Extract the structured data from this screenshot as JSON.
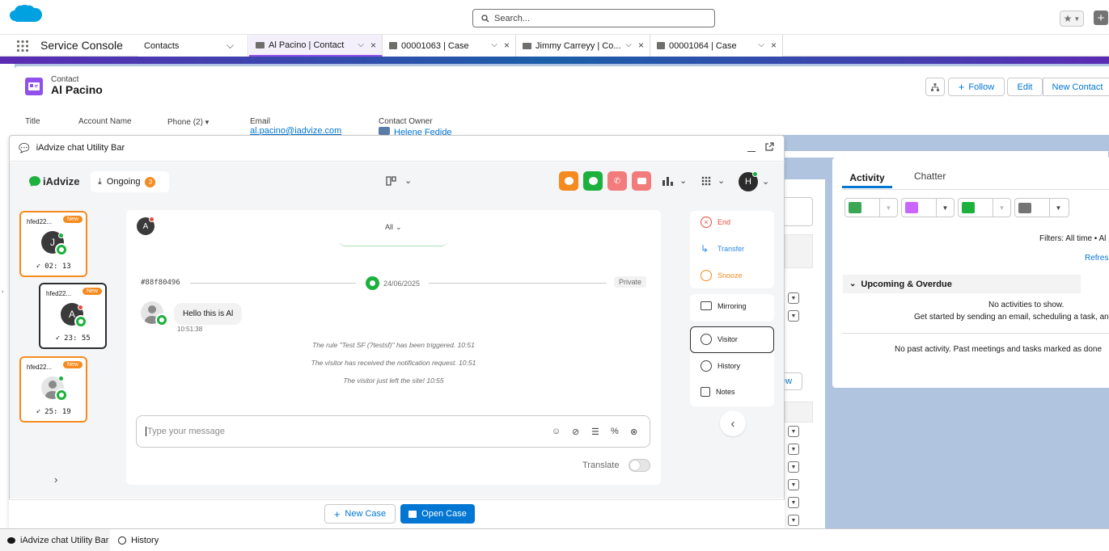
{
  "global_header": {
    "search_placeholder": "Search...",
    "add_label": "+"
  },
  "console": {
    "app_name": "Service Console",
    "nav_select": "Contacts",
    "tabs": [
      {
        "label": "Al Pacino | Contact",
        "active": true
      },
      {
        "label": "00001063 | Case",
        "active": false
      },
      {
        "label": "Jimmy Carreyy | Co...",
        "active": false
      },
      {
        "label": "00001064 | Case",
        "active": false
      }
    ]
  },
  "record": {
    "object_label": "Contact",
    "name": "Al Pacino",
    "actions": {
      "follow": "Follow",
      "edit": "Edit",
      "new_contact": "New Contact"
    },
    "fields": {
      "title_label": "Title",
      "account_label": "Account Name",
      "phone_label": "Phone (2)",
      "email_label": "Email",
      "email_value": "al.pacino@iadvize.com",
      "owner_label": "Contact Owner",
      "owner_value": "Helene Fedide"
    }
  },
  "activity": {
    "tab_activity": "Activity",
    "tab_chatter": "Chatter",
    "filters": "Filters: All time • Al",
    "refresh": "Refresh",
    "section": "Upcoming & Overdue",
    "no_activities": "No activities to show.",
    "get_started": "Get started by sending an email, scheduling a task, an",
    "no_past": "No past activity. Past meetings and tasks marked as done",
    "colors": {
      "task": "#3ba755",
      "event": "#cb65ff",
      "call": "#1bb13c",
      "email": "#747474"
    }
  },
  "behind": {
    "new_btn_fragment": "ew"
  },
  "utility_popup": {
    "title": "iAdvize chat Utility Bar"
  },
  "iadvize": {
    "logo": "iAdvize",
    "ongoing_label": "Ongoing",
    "ongoing_count": "3",
    "agent_initial": "H",
    "colors": {
      "orange": "#f58b1f",
      "green": "#1bb13c",
      "red": "#f27c7c",
      "accent": "#f58b1f"
    },
    "conversations": [
      {
        "id": "hfed22...",
        "badge": "New",
        "initial": "J",
        "timer": "02: 13",
        "status_color": "#1bb13c"
      },
      {
        "id": "hfed22...",
        "badge": "New",
        "initial": "A",
        "timer": "23: 55",
        "status_color": "#e74c3c"
      },
      {
        "id": "hfed22...",
        "badge": "New",
        "initial": "",
        "timer": "25: 19",
        "status_color": "#1bb13c"
      }
    ],
    "chat": {
      "visitor_initial": "A",
      "filter": "All",
      "conv_id": "#88f80496",
      "date": "24/06/2025",
      "private": "Private",
      "message": "Hello this is Al",
      "message_time": "10:51:38",
      "system_messages": [
        "The rule \"Test SF (?testsf)\" has been triggered.   10:51",
        "The visitor has received the notification request.   10:51",
        "The visitor just left the site!   10:55"
      ],
      "input_placeholder": "Type your message",
      "translate": "Translate"
    },
    "actions": {
      "end": "End",
      "transfer": "Transfer",
      "snooze": "Snooze",
      "mirroring": "Mirroring",
      "visitor": "Visitor",
      "history": "History",
      "notes": "Notes"
    }
  },
  "case_footer": {
    "new_case": "New Case",
    "open_case": "Open Case"
  },
  "utility_bar": {
    "item1": "iAdvize chat Utility Bar",
    "item2": "History"
  }
}
